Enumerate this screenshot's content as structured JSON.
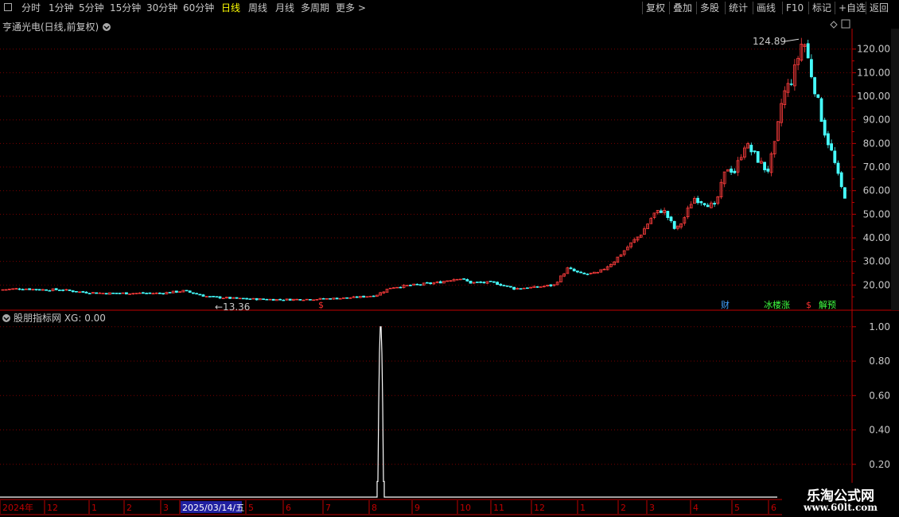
{
  "toolbar": {
    "left_items": [
      "分时",
      "1分钟",
      "5分钟",
      "15分钟",
      "30分钟",
      "60分钟",
      "日线",
      "周线",
      "月线",
      "多周期",
      "更多 >"
    ],
    "active_index": 6,
    "right_items": [
      "复权",
      "叠加",
      "多股",
      "统计",
      "画线",
      "F10",
      "标记",
      "+自选",
      "返回"
    ]
  },
  "main_panel": {
    "title": "亨通光电(日线,前复权)",
    "high_label": "124.89",
    "low_label": "13.36",
    "markers": [
      {
        "text": "$",
        "color": "#ff3030"
      },
      {
        "text": "财",
        "color": "#40a0ff"
      },
      {
        "text": "冰楼涨",
        "color": "#40ff40"
      },
      {
        "text": "$",
        "color": "#ff3030"
      },
      {
        "text": "解预",
        "color": "#40ff40"
      }
    ]
  },
  "indicator_panel": {
    "title": "股朋指标网 XG: 0.00"
  },
  "x_axis": {
    "labels": [
      "2024年",
      "12",
      "1",
      "2",
      "3",
      "2025/03/14/五",
      "5",
      "6",
      "7",
      "8",
      "9",
      "10",
      "11",
      "12",
      "1",
      "2",
      "3",
      "4",
      "5",
      "6"
    ],
    "highlight_label": "2025/03/14/五"
  },
  "watermark": {
    "line1": "乐淘公式网",
    "line2": "www.60lt.com"
  },
  "colors": {
    "up": "#ff3c3c",
    "down": "#46ffff",
    "grid": "#7a0000",
    "axis": "#c00000",
    "indicator": "#ffffff"
  },
  "chart_data": {
    "type": "candlestick",
    "price_axis": {
      "ticks": [
        20,
        30,
        40,
        50,
        60,
        70,
        80,
        90,
        100,
        110,
        120
      ],
      "range": [
        10,
        128
      ]
    },
    "indicator_axis": {
      "ticks": [
        0.2,
        0.4,
        0.6,
        0.8,
        1.0
      ],
      "range": [
        0,
        1.05
      ]
    },
    "close_anchors": [
      [
        0,
        18
      ],
      [
        25,
        18.5
      ],
      [
        50,
        18
      ],
      [
        75,
        18
      ],
      [
        100,
        17
      ],
      [
        130,
        16.5
      ],
      [
        165,
        16.5
      ],
      [
        200,
        16.5
      ],
      [
        230,
        17.5
      ],
      [
        260,
        15
      ],
      [
        300,
        14.2
      ],
      [
        350,
        13.8
      ],
      [
        395,
        14
      ],
      [
        435,
        14.5
      ],
      [
        470,
        15.5
      ],
      [
        490,
        19
      ],
      [
        520,
        20
      ],
      [
        548,
        21
      ],
      [
        575,
        23
      ],
      [
        590,
        21
      ],
      [
        620,
        21
      ],
      [
        645,
        18.5
      ],
      [
        670,
        19
      ],
      [
        695,
        20
      ],
      [
        712,
        27
      ],
      [
        730,
        24.5
      ],
      [
        750,
        25
      ],
      [
        770,
        30
      ],
      [
        790,
        37
      ],
      [
        805,
        42
      ],
      [
        820,
        50
      ],
      [
        832,
        52
      ],
      [
        848,
        43
      ],
      [
        858,
        48
      ],
      [
        870,
        57
      ],
      [
        885,
        55
      ],
      [
        897,
        53
      ],
      [
        912,
        70
      ],
      [
        922,
        68
      ],
      [
        935,
        80
      ],
      [
        947,
        75
      ],
      [
        963,
        68
      ],
      [
        973,
        80
      ],
      [
        982,
        100
      ],
      [
        995,
        108
      ],
      [
        1008,
        125
      ],
      [
        1018,
        110
      ],
      [
        1025,
        100
      ],
      [
        1035,
        85
      ],
      [
        1045,
        75
      ],
      [
        1055,
        62
      ],
      [
        1063,
        56
      ]
    ],
    "high": 124.89,
    "low": 13.36,
    "xg_signal": {
      "x_index": 480,
      "value": 1.0
    }
  }
}
